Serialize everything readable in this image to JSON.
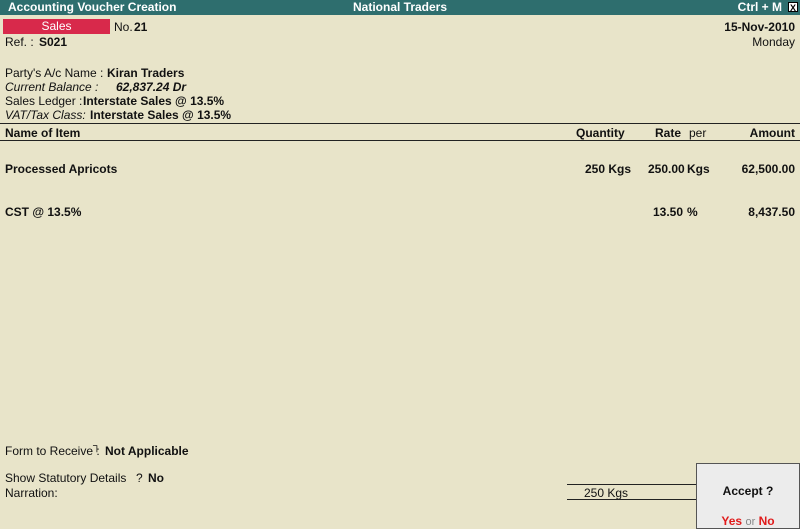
{
  "window": {
    "title": "Accounting Voucher  Creation",
    "company": "National Traders",
    "shortcut": "Ctrl + M",
    "close_glyph": "X"
  },
  "voucher": {
    "type": "Sales",
    "no_label": "No.",
    "no": "21",
    "date": "15-Nov-2010",
    "day": "Monday",
    "ref_label": "Ref. :",
    "ref": "S021"
  },
  "party": {
    "name_label": "Party's A/c Name  :",
    "name": "Kiran Traders",
    "balance_label": "Current Balance  :",
    "balance": "62,837.24 Dr",
    "ledger_label": "Sales Ledger :",
    "ledger": "Interstate Sales @ 13.5%",
    "vat_label": "VAT/Tax Class:",
    "vat": "Interstate Sales @ 13.5%"
  },
  "table": {
    "headers": {
      "item": "Name of Item",
      "quantity": "Quantity",
      "rate": "Rate",
      "per": "per",
      "amount": "Amount"
    },
    "rows": [
      {
        "item": "Processed Apricots",
        "quantity": "250 Kgs",
        "rate": "250.00",
        "per": "Kgs",
        "amount": "62,500.00"
      },
      {
        "item": "CST @ 13.5%",
        "quantity": "",
        "rate": "13.50",
        "per": "%",
        "amount": "8,437.50"
      }
    ]
  },
  "footer": {
    "form_label": "Form to Receive  :",
    "form_marker": "┐",
    "form_value": "Not Applicable",
    "statutory_label": "Show Statutory Details",
    "statutory_q": "?",
    "statutory_value": "No",
    "narration_label": "Narration:",
    "total_qty": "250 Kgs"
  },
  "dialog": {
    "question": "Accept ?",
    "yes": "Yes",
    "or": "or",
    "no": "No"
  }
}
